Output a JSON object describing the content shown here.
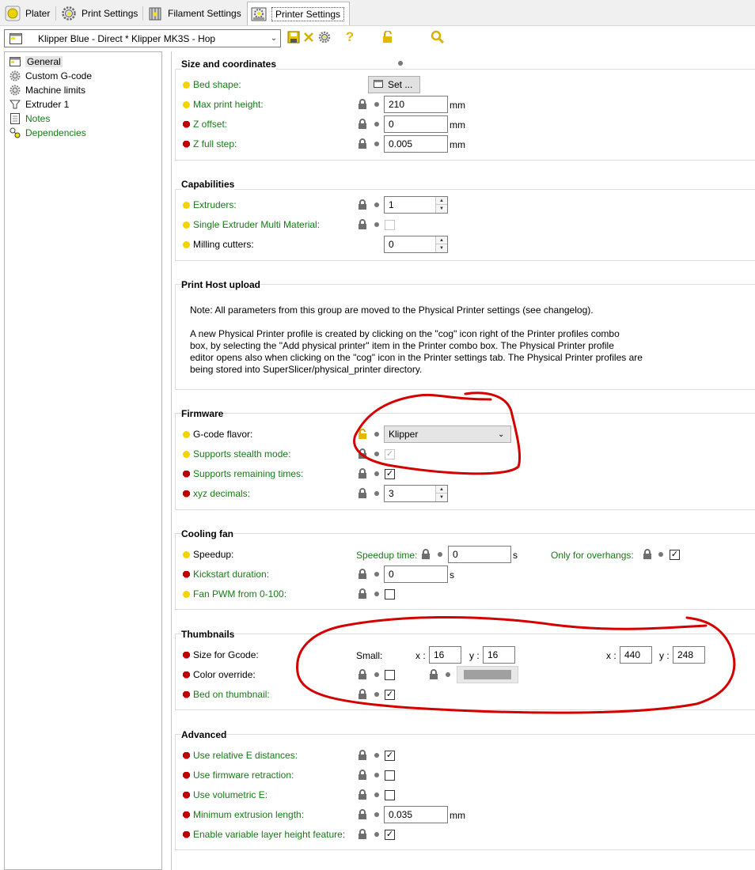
{
  "tabs": [
    {
      "label": "Plater",
      "icon": "plater-icon"
    },
    {
      "label": "Print Settings",
      "icon": "gear-icon"
    },
    {
      "label": "Filament Settings",
      "icon": "spool-icon"
    },
    {
      "label": "Printer Settings",
      "icon": "printer-icon",
      "active": true
    }
  ],
  "toolbar": {
    "preset": "Klipper Blue - Direct * Klipper MK3S - Hop",
    "icons": [
      "save-icon",
      "delete-icon",
      "cog-icon",
      "help-icon",
      "lock-icon",
      "search-icon"
    ],
    "help_glyph": "?"
  },
  "nav": [
    {
      "label": "General",
      "icon": "general-icon",
      "selected": true
    },
    {
      "label": "Custom G-code",
      "icon": "gear-icon"
    },
    {
      "label": "Machine limits",
      "icon": "gear-icon"
    },
    {
      "label": "Extruder 1",
      "icon": "extruder-icon"
    },
    {
      "label": "Notes",
      "icon": "notes-icon",
      "green": true
    },
    {
      "label": "Dependencies",
      "icon": "dependencies-icon",
      "green": true
    }
  ],
  "size": {
    "title": "Size and coordinates",
    "bed_shape": "Bed shape:",
    "set_button": "Set ...",
    "max_height_label": "Max print height:",
    "max_height": "210",
    "z_offset_label": "Z offset:",
    "z_offset": "0",
    "z_step_label": "Z full step:",
    "z_step": "0.005",
    "unit": "mm"
  },
  "capabilities": {
    "title": "Capabilities",
    "extruders_label": "Extruders:",
    "extruders": "1",
    "semm_label": "Single Extruder Multi Material:",
    "milling_label": "Milling cutters:",
    "milling": "0"
  },
  "host": {
    "title": "Print Host upload",
    "note1": "Note: All parameters from this group are moved to the Physical Printer settings (see changelog).",
    "note2_l1": "A new Physical Printer profile is created by clicking on the \"cog\" icon right of the Printer profiles combo",
    "note2_l2": "box, by selecting the \"Add physical printer\" item in the Printer combo box. The Physical Printer profile",
    "note2_l3": "editor opens also when clicking on the \"cog\" icon in the Printer settings tab. The Physical Printer profiles are",
    "note2_l4": "being stored into SuperSlicer/physical_printer directory."
  },
  "firmware": {
    "title": "Firmware",
    "flavor_label": "G-code flavor:",
    "flavor": "Klipper",
    "stealth_label": "Supports stealth mode:",
    "remaining_label": "Supports remaining times:",
    "decimals_label": "xyz decimals:",
    "decimals": "3"
  },
  "cooling": {
    "title": "Cooling fan",
    "speedup_label": "Speedup:",
    "speedup_time_label": "Speedup time:",
    "speedup_time": "0",
    "speedup_unit": "s",
    "overhangs_label": "Only for overhangs:",
    "kickstart_label": "Kickstart duration:",
    "kickstart": "0",
    "kickstart_unit": "s",
    "pwm_label": "Fan PWM from 0-100:"
  },
  "thumbs": {
    "title": "Thumbnails",
    "size_label": "Size for Gcode:",
    "small_label": "Small:",
    "x_label": "x :",
    "y_label": "y :",
    "small_x": "16",
    "small_y": "16",
    "big_x": "440",
    "big_y": "248",
    "color_label": "Color override:",
    "bed_label": "Bed on thumbnail:"
  },
  "advanced": {
    "title": "Advanced",
    "relative_label": "Use relative E distances:",
    "fw_retract_label": "Use firmware retraction:",
    "volumetric_label": "Use volumetric E:",
    "min_ext_label": "Minimum extrusion length:",
    "min_ext": "0.035",
    "min_ext_unit": "mm",
    "var_layer_label": "Enable variable layer height feature:"
  },
  "checks": {
    "semm": false,
    "stealth": true,
    "remaining": true,
    "overhangs": true,
    "pwm": false,
    "color_override": false,
    "bed_thumbnail": true,
    "relative_e": true,
    "fw_retraction": false,
    "volumetric": false,
    "variable_layer": true
  },
  "colors": {
    "green_label": "#177a17",
    "yellow_dot": "#f2d400",
    "red_dot": "#c00000",
    "annotation": "#d40000",
    "color_swatch": "#a0a0a0"
  }
}
